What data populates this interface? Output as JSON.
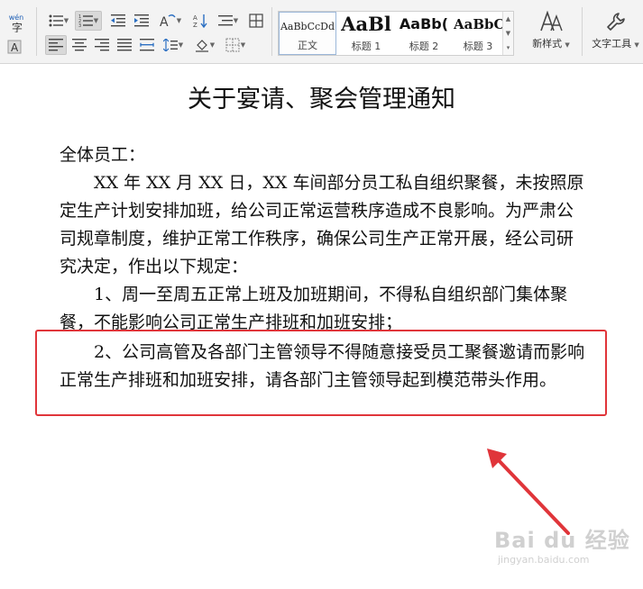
{
  "ribbon": {
    "phonetic_icon_text": "wén",
    "styles": [
      {
        "preview": "AaBbCcDd",
        "name": "正文"
      },
      {
        "preview": "AaBl",
        "name": "标题 1"
      },
      {
        "preview": "AaBb(",
        "name": "标题 2"
      },
      {
        "preview": "AaBbC",
        "name": "标题 3"
      }
    ],
    "new_style_label": "新样式",
    "text_tools_label": "文字工具"
  },
  "document": {
    "title": "关于宴请、聚会管理通知",
    "greeting": "全体员工：",
    "paragraph1": "XX 年 XX 月 XX 日，XX 车间部分员工私自组织聚餐，未按照原定生产计划安排加班，给公司正常运营秩序造成不良影响。为严肃公司规章制度，维护正常工作秩序，确保公司生产正常开展，经公司研究决定，作出以下规定：",
    "rule1": "1、周一至周五正常上班及加班期间，不得私自组织部门集体聚餐，不能影响公司正常生产排班和加班安排；",
    "rule2": "2、公司高管及各部门主管领导不得随意接受员工聚餐邀请而影响正常生产排班和加班安排，请各部门主管领导起到模范带头作用。"
  },
  "annotation": {
    "box_color": "#e0353a",
    "arrow_color": "#e0353a"
  },
  "watermark": {
    "brand": "Bai du 经验",
    "url": "jingyan.baidu.com"
  }
}
